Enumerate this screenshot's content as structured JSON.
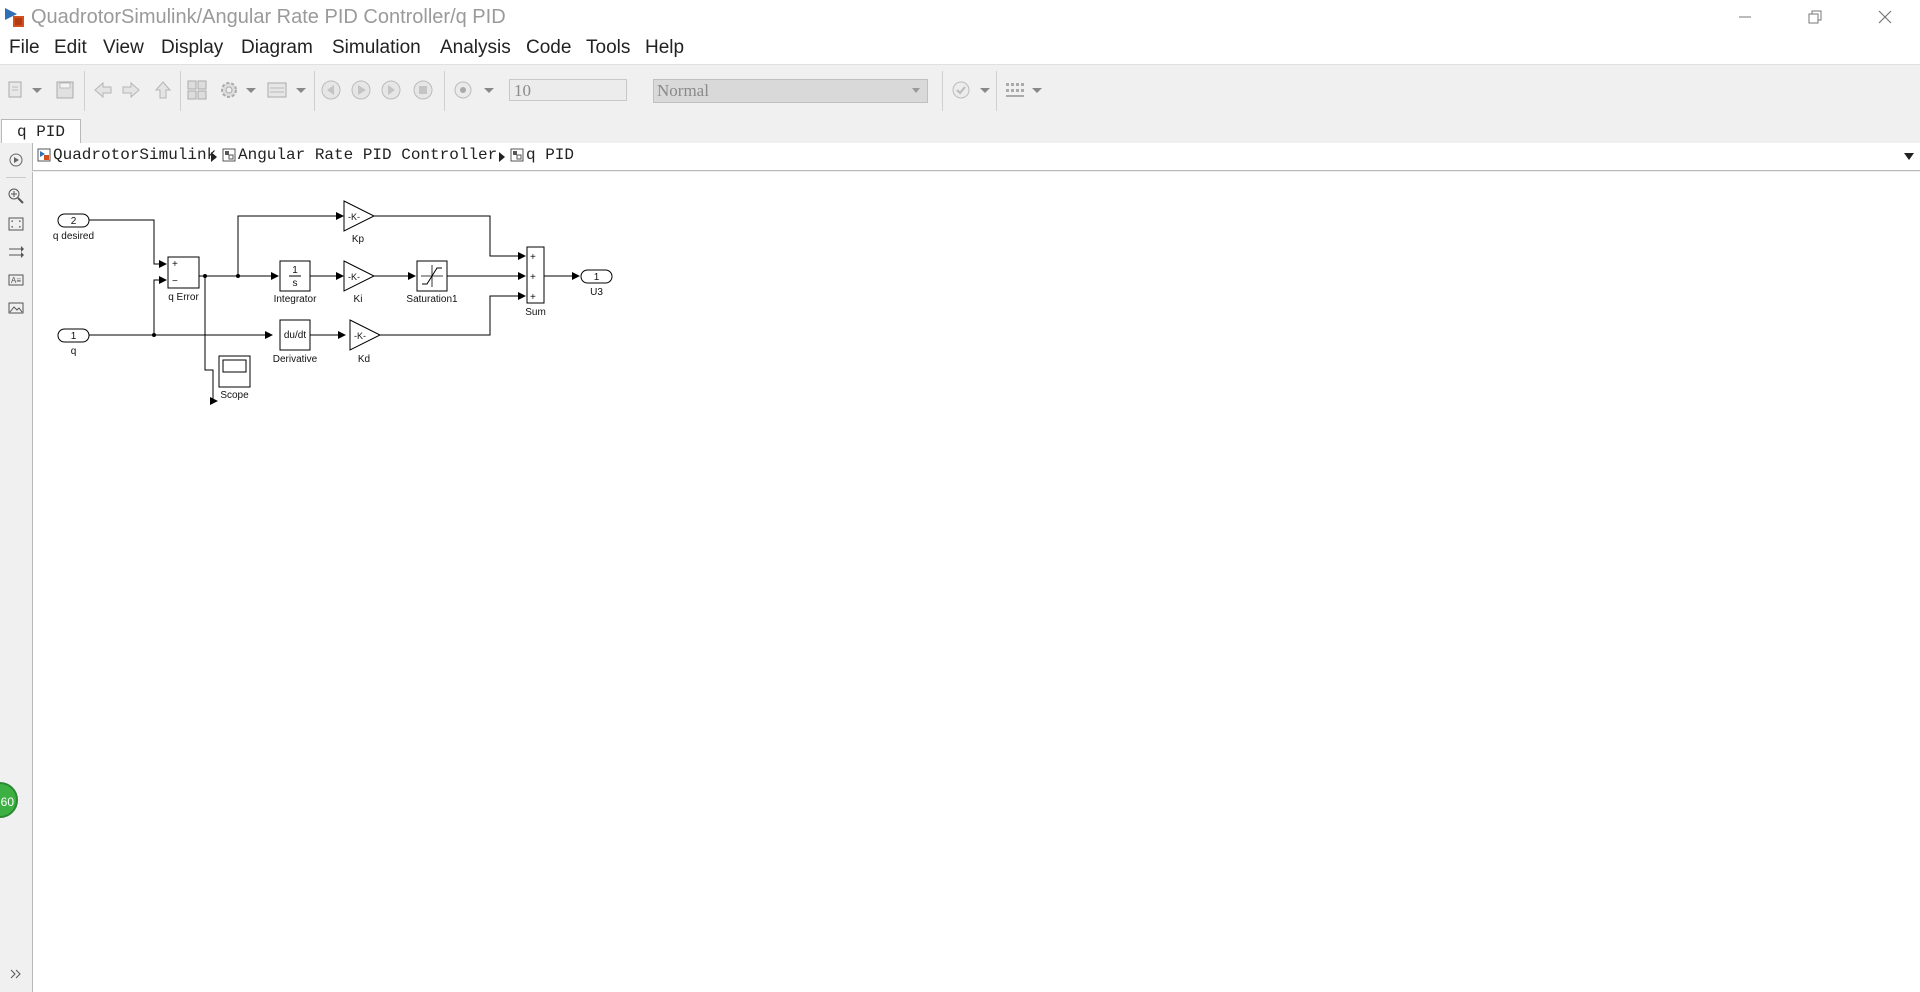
{
  "window": {
    "title": "QuadrotorSimulink/Angular Rate  PID Controller/q PID",
    "minimize_icon": "minimize-icon",
    "restore_icon": "restore-icon",
    "close_icon": "close-icon"
  },
  "menu": {
    "items": [
      "File",
      "Edit",
      "View",
      "Display",
      "Diagram",
      "Simulation",
      "Analysis",
      "Code",
      "Tools",
      "Help"
    ]
  },
  "toolbar": {
    "stop_time": "10",
    "sim_mode": "Normal"
  },
  "tabs": [
    "q PID"
  ],
  "breadcrumb": {
    "items": [
      "QuadrotorSimulink",
      "Angular Rate  PID Controller",
      "q PID"
    ]
  },
  "badge": {
    "text": "60",
    "color": "#3cb043"
  },
  "diagram": {
    "blocks": {
      "in_q_desired": {
        "port": "2",
        "label": "q desired"
      },
      "in_q": {
        "port": "1",
        "label": "q"
      },
      "sum_error": {
        "signs": [
          "+",
          "−"
        ],
        "label": "q Error"
      },
      "gain_kp": {
        "text": "-K-",
        "label": "Kp"
      },
      "integrator": {
        "num": "1",
        "den": "s",
        "label": "Integrator"
      },
      "gain_ki": {
        "text": "-K-",
        "label": "Ki"
      },
      "saturation": {
        "label": "Saturation1"
      },
      "derivative": {
        "text": "du/dt",
        "label": "Derivative"
      },
      "gain_kd": {
        "text": "-K-",
        "label": "Kd"
      },
      "scope": {
        "label": "Scope"
      },
      "sum": {
        "signs": [
          "+",
          "+",
          "+"
        ],
        "label": "Sum"
      },
      "out_u3": {
        "port": "1",
        "label": "U3"
      }
    }
  }
}
